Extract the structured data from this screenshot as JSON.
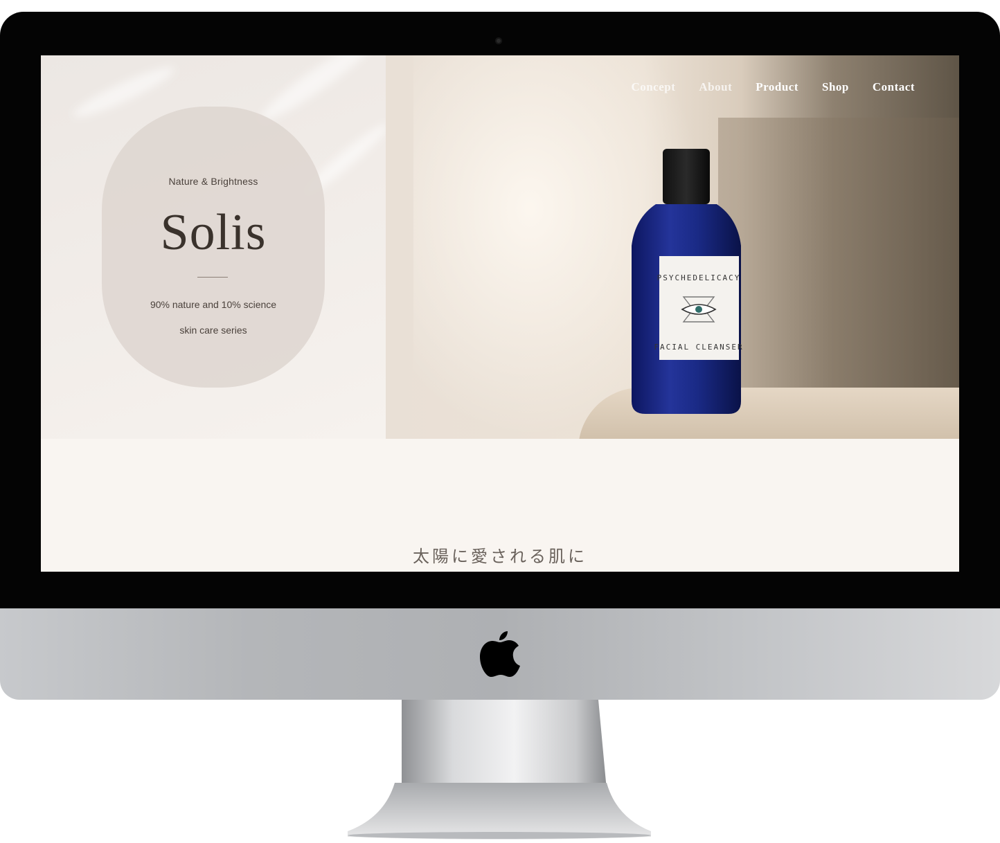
{
  "site": {
    "nav": [
      {
        "label": "Concept"
      },
      {
        "label": "About"
      },
      {
        "label": "Product"
      },
      {
        "label": "Shop"
      },
      {
        "label": "Contact"
      }
    ],
    "hero": {
      "tagline": "Nature & Brightness",
      "brand": "Solis",
      "description_line1": "90% nature and 10%  science",
      "description_line2": "skin care series"
    },
    "product_label": {
      "top": "PSYCHEDELICACY",
      "bottom": "FACIAL CLEANSER"
    },
    "intro_title": "太陽に愛される肌に"
  },
  "device": {
    "icon": "apple-logo-icon"
  },
  "colors": {
    "bottle": "#1f2f8c",
    "background": "#f9f5f1",
    "capsule": "#ded6d0"
  }
}
